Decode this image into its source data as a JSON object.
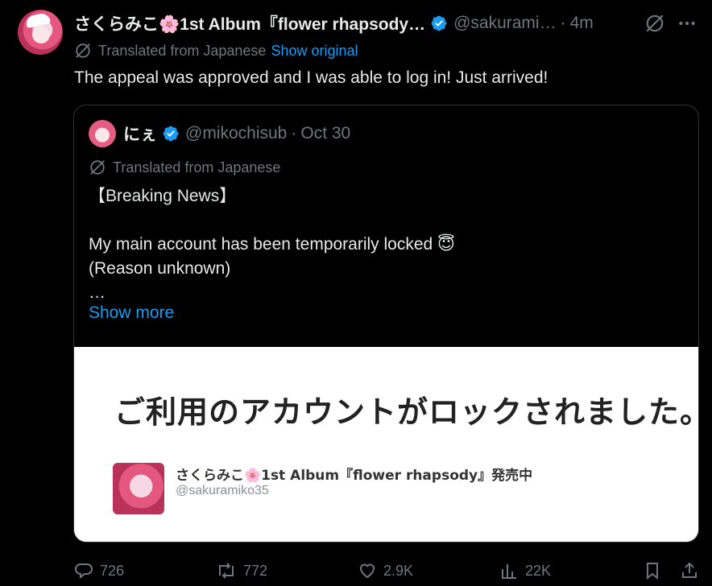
{
  "post": {
    "author_name": "さくらみこ🌸1st Album『flower rhapsody…",
    "handle": "@sakurami…",
    "dot": "·",
    "time": "4m",
    "translated_label": "Translated from Japanese",
    "show_original": "Show original",
    "text": "The appeal was approved and I was able to log in! Just arrived!"
  },
  "quote": {
    "author_name": "にぇ",
    "handle": "@mikochisub",
    "dot": "·",
    "time": "Oct 30",
    "translated_label": "Translated from Japanese",
    "body": "【Breaking News】\n\nMy main account has been temporarily locked 😇\n(Reason unknown)\n…",
    "show_more": "Show more",
    "image": {
      "title": "ご利用のアカウントがロックされました。",
      "account_name": "さくらみこ🌸1st Album『flower rhapsody』発売中",
      "account_handle": "@sakuramiko35"
    }
  },
  "actions": {
    "replies": "726",
    "reposts": "772",
    "likes": "2.9K",
    "views": "22K"
  },
  "colors": {
    "background": "#000000",
    "text": "#e7e9ea",
    "muted": "#71767b",
    "accent": "#1d9bf0",
    "border": "#2f3336"
  },
  "icons": [
    "translate-icon",
    "verified-icon",
    "more-icon",
    "reply-icon",
    "repost-icon",
    "like-icon",
    "views-icon",
    "bookmark-icon",
    "share-icon"
  ]
}
